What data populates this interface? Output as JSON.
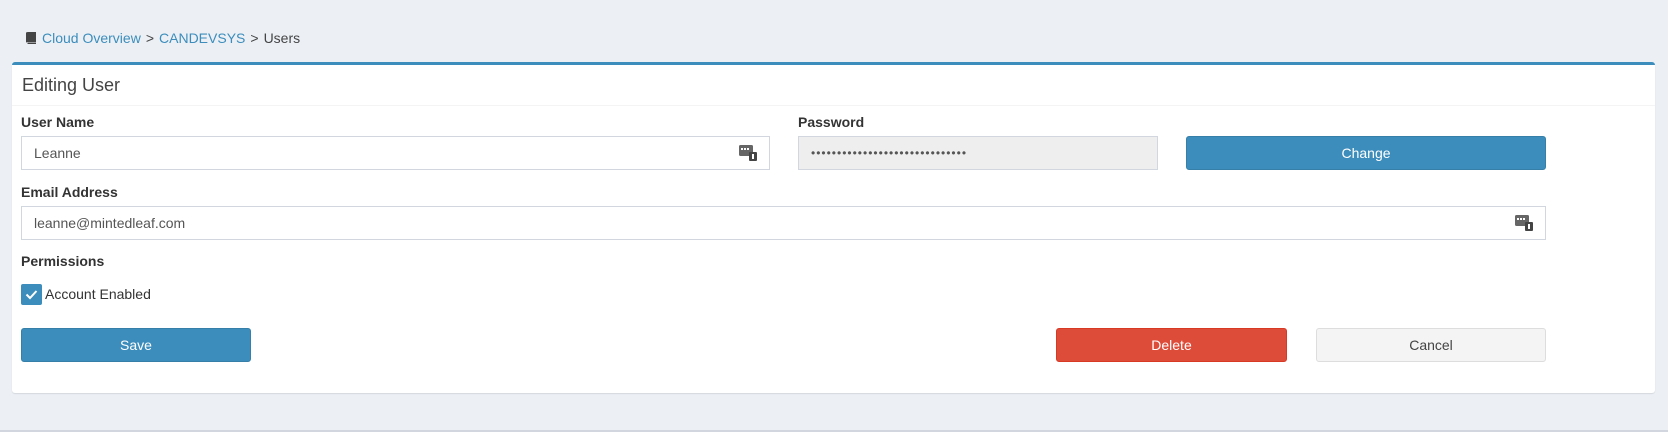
{
  "breadcrumb": {
    "icon": "book-icon",
    "items": [
      "Cloud Overview",
      "CANDEVSYS",
      "Users"
    ],
    "separator": ">"
  },
  "box": {
    "title": "Editing User"
  },
  "form": {
    "username": {
      "label": "User Name",
      "value": "Leanne"
    },
    "password": {
      "label": "Password",
      "value": "••••••••••••••••••••••••••••••"
    },
    "change_label": "Change",
    "email": {
      "label": "Email Address",
      "value": "leanne@mintedleaf.com"
    },
    "permissions": {
      "label": "Permissions",
      "account_enabled": {
        "label": "Account Enabled",
        "checked": true
      }
    }
  },
  "actions": {
    "save_label": "Save",
    "delete_label": "Delete",
    "cancel_label": "Cancel"
  },
  "colors": {
    "primary": "#3c8dbc",
    "danger": "#dd4b39",
    "background": "#ecf0f5"
  }
}
